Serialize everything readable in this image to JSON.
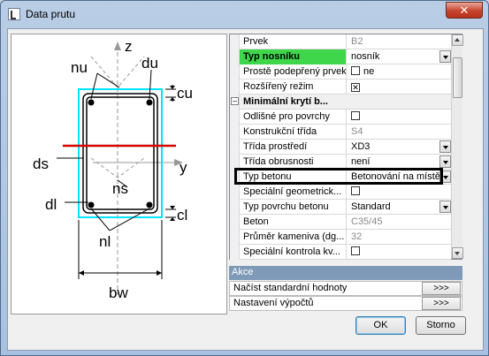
{
  "window": {
    "title": "Data prutu",
    "close_glyph": "✕"
  },
  "drawing": {
    "labels": {
      "z": "z",
      "y": "y",
      "nu": "nu",
      "du": "du",
      "cu": "cu",
      "ds": "ds",
      "ns": "ns",
      "dl": "dl",
      "cl": "cl",
      "nl": "nl",
      "bw": "bw"
    },
    "colors": {
      "stirrup_outline": "#00e5ff",
      "neutral_axis": "#d40000"
    }
  },
  "properties": [
    {
      "name": "Prvek",
      "value": "B2",
      "value_style": "gray"
    },
    {
      "name": "Typ nosníku",
      "value": "nosník",
      "name_style": "green",
      "dropdown": true
    },
    {
      "name": "Prostě podepřený prvek",
      "value": "ne",
      "checkbox": "unchecked"
    },
    {
      "name": "Rozšířený režim",
      "value": "",
      "checkbox": "checked-x"
    },
    {
      "name": "Minimální krytí b...",
      "value": "",
      "name_style": "bold",
      "group": true
    },
    {
      "name": "Odlišné pro povrchy",
      "value": "",
      "checkbox": "unchecked"
    },
    {
      "name": "Konstrukční třída",
      "value": "S4",
      "value_style": "gray"
    },
    {
      "name": "Třída prostředí",
      "value": "XD3",
      "dropdown": true,
      "highlighted": true
    },
    {
      "name": "Třída obrusnosti",
      "value": "není",
      "dropdown": true
    },
    {
      "name": "Typ betonu",
      "value": "Betonování na místě",
      "dropdown": true
    },
    {
      "name": "Speciální geometrick...",
      "value": "",
      "checkbox": "unchecked"
    },
    {
      "name": "Typ povrchu betonu",
      "value": "Standard",
      "dropdown": true
    },
    {
      "name": "Beton",
      "value": "C35/45",
      "value_style": "gray"
    },
    {
      "name": "Průměr kameniva (dg...",
      "value": "32",
      "value_style": "gray"
    },
    {
      "name": "Speciální kontrola kv...",
      "value": "",
      "checkbox": "unchecked"
    }
  ],
  "actions": {
    "header": "Akce",
    "items": [
      {
        "label": "Načíst standardní hodnoty",
        "button": ">>>"
      },
      {
        "label": "Nastavení výpočtů",
        "button": ">>>"
      }
    ]
  },
  "buttons": {
    "ok": "OK",
    "cancel": "Storno"
  }
}
